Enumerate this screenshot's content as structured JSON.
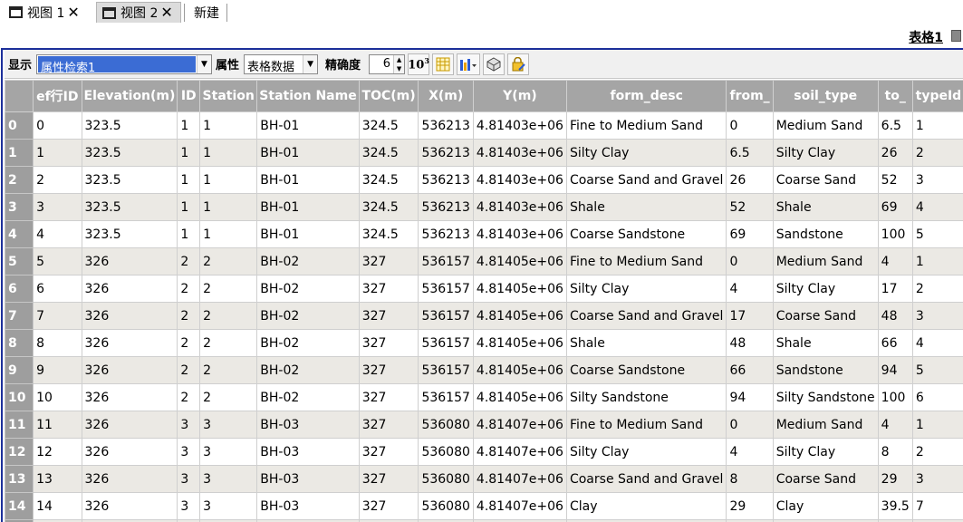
{
  "tabs": [
    {
      "label": "视图 1",
      "closable": true
    },
    {
      "label": "视图 2",
      "closable": true
    },
    {
      "label": "新建",
      "closable": false
    }
  ],
  "sheet_title": "表格1",
  "toolbar": {
    "display_label": "显示",
    "display_value": "属性检索1",
    "attr_label": "属性",
    "attr_value": "表格数据",
    "precision_label": "精确度",
    "precision_value": "6",
    "pow_base": "10",
    "pow_exp": "3"
  },
  "table": {
    "columns": [
      "ef行ID",
      "Elevation(m)",
      "ID",
      "Station",
      "Station Name",
      "TOC(m)",
      "X(m)",
      "Y(m)",
      "form_desc",
      "from_",
      "soil_type",
      "to_",
      "typeId"
    ],
    "rows": [
      [
        "0",
        "0",
        "323.5",
        "1",
        "1",
        "BH-01",
        "324.5",
        "536213",
        "4.81403e+06",
        "Fine to Medium Sand",
        "0",
        "Medium Sand",
        "6.5",
        "1"
      ],
      [
        "1",
        "1",
        "323.5",
        "1",
        "1",
        "BH-01",
        "324.5",
        "536213",
        "4.81403e+06",
        "Silty Clay",
        "6.5",
        "Silty Clay",
        "26",
        "2"
      ],
      [
        "2",
        "2",
        "323.5",
        "1",
        "1",
        "BH-01",
        "324.5",
        "536213",
        "4.81403e+06",
        "Coarse Sand and Gravel",
        "26",
        "Coarse Sand",
        "52",
        "3"
      ],
      [
        "3",
        "3",
        "323.5",
        "1",
        "1",
        "BH-01",
        "324.5",
        "536213",
        "4.81403e+06",
        "Shale",
        "52",
        "Shale",
        "69",
        "4"
      ],
      [
        "4",
        "4",
        "323.5",
        "1",
        "1",
        "BH-01",
        "324.5",
        "536213",
        "4.81403e+06",
        "Coarse Sandstone",
        "69",
        "Sandstone",
        "100",
        "5"
      ],
      [
        "5",
        "5",
        "326",
        "2",
        "2",
        "BH-02",
        "327",
        "536157",
        "4.81405e+06",
        "Fine to Medium Sand",
        "0",
        "Medium Sand",
        "4",
        "1"
      ],
      [
        "6",
        "6",
        "326",
        "2",
        "2",
        "BH-02",
        "327",
        "536157",
        "4.81405e+06",
        "Silty Clay",
        "4",
        "Silty Clay",
        "17",
        "2"
      ],
      [
        "7",
        "7",
        "326",
        "2",
        "2",
        "BH-02",
        "327",
        "536157",
        "4.81405e+06",
        "Coarse Sand and Gravel",
        "17",
        "Coarse Sand",
        "48",
        "3"
      ],
      [
        "8",
        "8",
        "326",
        "2",
        "2",
        "BH-02",
        "327",
        "536157",
        "4.81405e+06",
        "Shale",
        "48",
        "Shale",
        "66",
        "4"
      ],
      [
        "9",
        "9",
        "326",
        "2",
        "2",
        "BH-02",
        "327",
        "536157",
        "4.81405e+06",
        "Coarse Sandstone",
        "66",
        "Sandstone",
        "94",
        "5"
      ],
      [
        "10",
        "10",
        "326",
        "2",
        "2",
        "BH-02",
        "327",
        "536157",
        "4.81405e+06",
        "Silty Sandstone",
        "94",
        "Silty Sandstone",
        "100",
        "6"
      ],
      [
        "11",
        "11",
        "326",
        "3",
        "3",
        "BH-03",
        "327",
        "536080",
        "4.81407e+06",
        "Fine to Medium Sand",
        "0",
        "Medium Sand",
        "4",
        "1"
      ],
      [
        "12",
        "12",
        "326",
        "3",
        "3",
        "BH-03",
        "327",
        "536080",
        "4.81407e+06",
        "Silty Clay",
        "4",
        "Silty Clay",
        "8",
        "2"
      ],
      [
        "13",
        "13",
        "326",
        "3",
        "3",
        "BH-03",
        "327",
        "536080",
        "4.81407e+06",
        "Coarse Sand and Gravel",
        "8",
        "Coarse Sand",
        "29",
        "3"
      ],
      [
        "14",
        "14",
        "326",
        "3",
        "3",
        "BH-03",
        "327",
        "536080",
        "4.81407e+06",
        "Clay",
        "29",
        "Clay",
        "39.5",
        "7"
      ],
      [
        "",
        "",
        "",
        "",
        "",
        "",
        "",
        "",
        "",
        "",
        "",
        "",
        "",
        ""
      ]
    ]
  },
  "colors": {
    "frame_border": "#1c2f9a",
    "header_bg": "#a5a5a5",
    "row_alt_bg": "#ebe9e4",
    "combo_selected": "#3b6cd4"
  }
}
